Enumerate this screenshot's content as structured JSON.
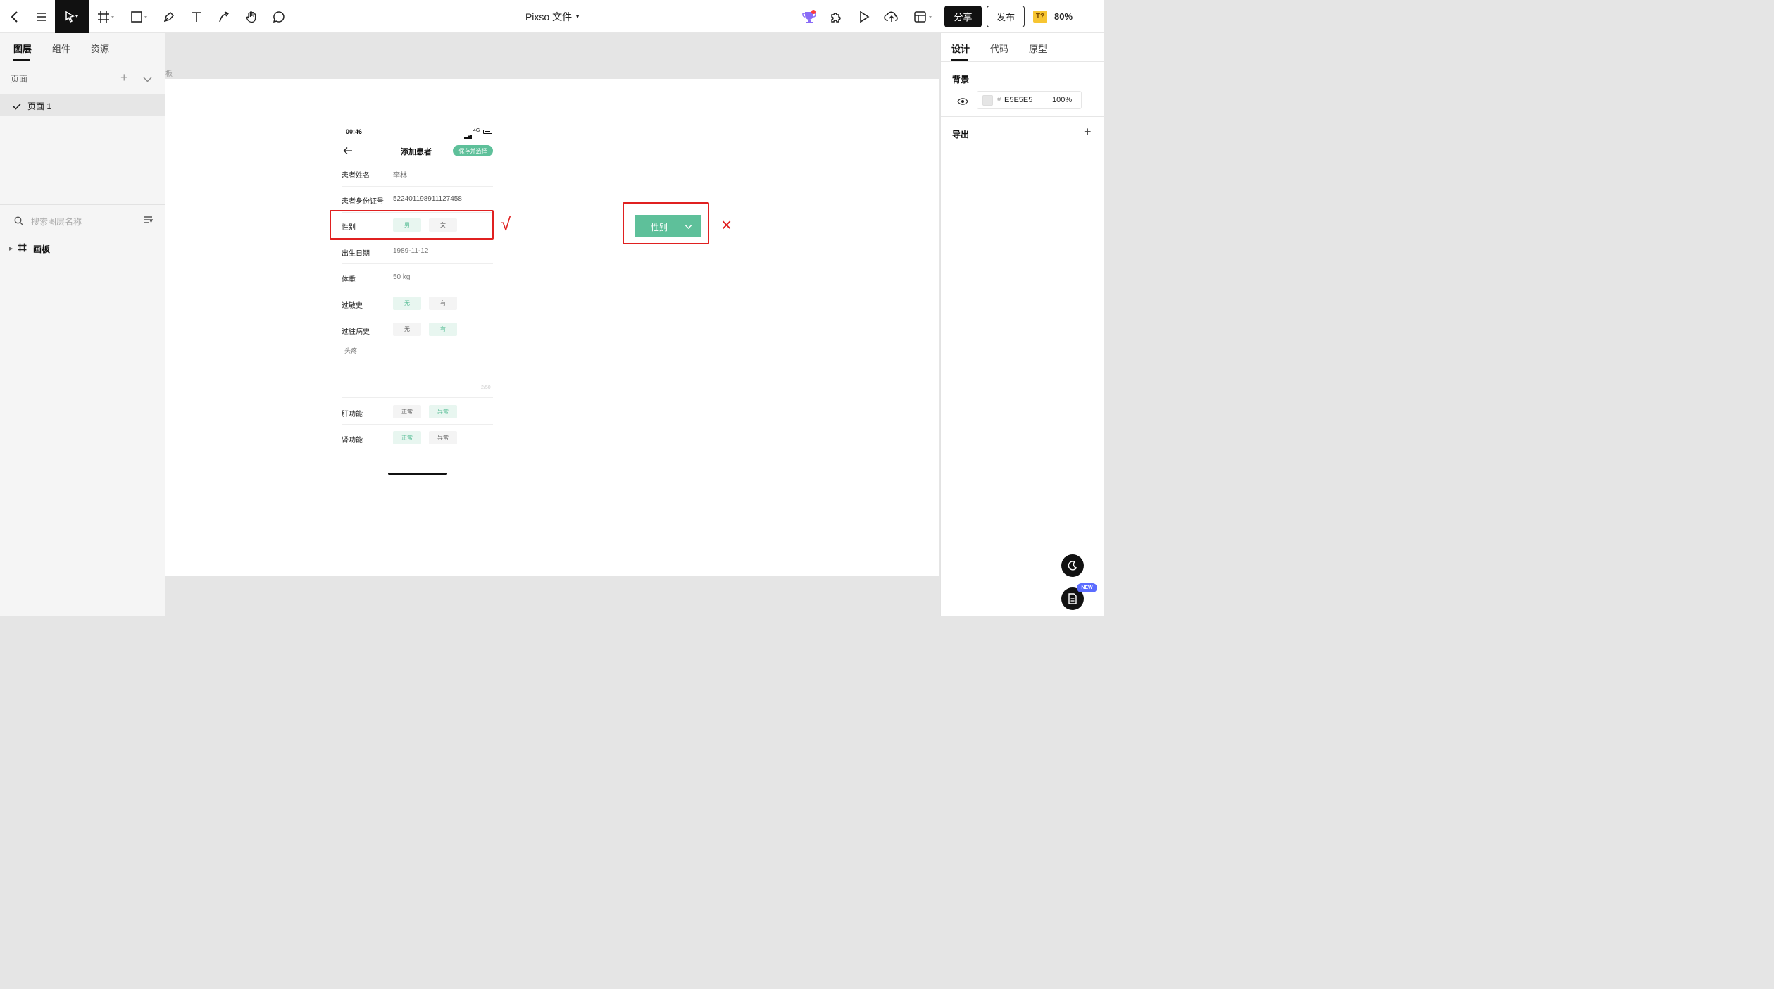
{
  "topbar": {
    "title": "Pixso 文件",
    "share_label": "分享",
    "publish_label": "发布",
    "font_badge": "T?",
    "zoom": "80%",
    "icons": [
      "back-icon",
      "menu-icon",
      "move-tool-icon",
      "frame-tool-icon",
      "shape-tool-icon",
      "pen-tool-icon",
      "text-tool-icon",
      "connector-tool-icon",
      "hand-tool-icon",
      "comment-tool-icon",
      "award-icon",
      "plugin-icon",
      "play-icon",
      "upload-icon",
      "layout-icon"
    ]
  },
  "left_panel": {
    "tabs": [
      "图层",
      "组件",
      "资源"
    ],
    "pages_header": "页面",
    "pages": [
      "页面 1"
    ],
    "search_placeholder": "搜索图层名称",
    "layers": [
      "画板"
    ]
  },
  "canvas": {
    "frame_label": "板",
    "phone": {
      "time": "00:46",
      "network": "4G",
      "title": "添加患者",
      "save_button": "保存并选择",
      "fields": [
        {
          "label": "患者姓名",
          "value": "李林"
        },
        {
          "label": "患者身份证号",
          "value": "522401198911127458"
        },
        {
          "label": "性别",
          "options": [
            "男",
            "女"
          ],
          "selected": "男"
        },
        {
          "label": "出生日期",
          "value": "1989-11-12"
        },
        {
          "label": "体重",
          "value": "50 kg"
        },
        {
          "label": "过敏史",
          "options": [
            "无",
            "有"
          ],
          "selected": "无"
        },
        {
          "label": "过往病史",
          "options": [
            "无",
            "有"
          ],
          "selected": "有"
        },
        {
          "label": "肝功能",
          "options": [
            "正常",
            "异常"
          ],
          "selected": "异常"
        },
        {
          "label": "肾功能",
          "options": [
            "正常",
            "异常"
          ],
          "selected": "正常"
        }
      ],
      "history_note": "头疼",
      "history_counter": "2/50"
    },
    "correct_mark": "√",
    "wrong_mark": "×",
    "dropdown_label": "性别",
    "annotation_color": "#e02020",
    "accent_color": "#5ec09a"
  },
  "right_panel": {
    "tabs": [
      "设计",
      "代码",
      "原型"
    ],
    "background_title": "背景",
    "background_hex": "E5E5E5",
    "background_opacity": "100%",
    "export_title": "导出",
    "new_badge": "NEW"
  }
}
